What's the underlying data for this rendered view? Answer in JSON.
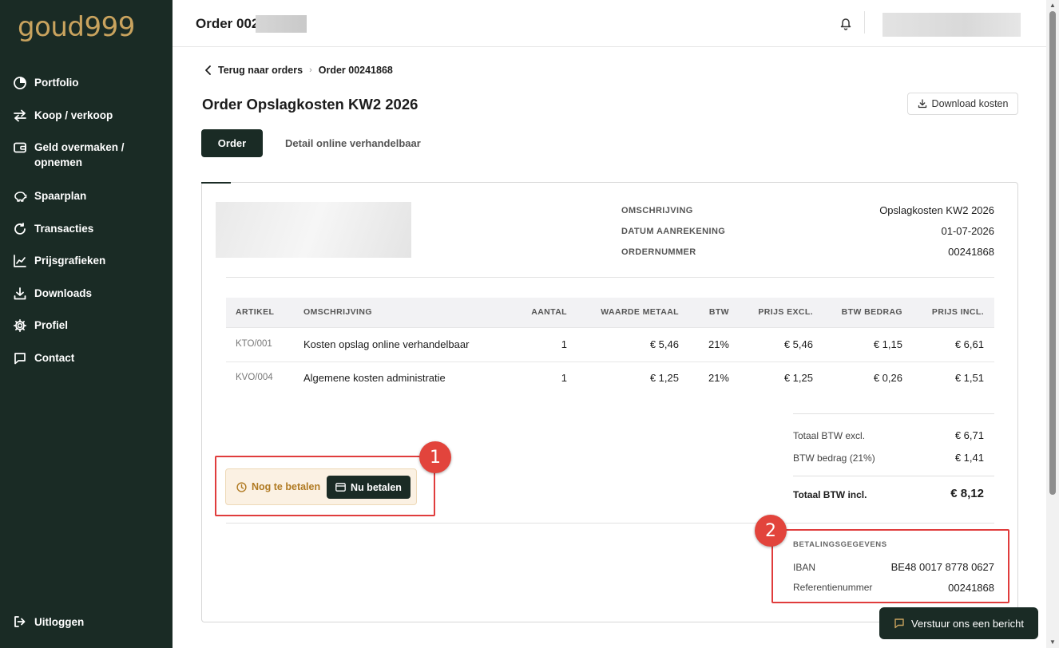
{
  "brand": {
    "logo_text": "goud999",
    "accent": "#c9a35e",
    "dark": "#1a2b25"
  },
  "sidebar": {
    "items": [
      {
        "label": "Portfolio",
        "icon": "pie-chart-icon"
      },
      {
        "label": "Koop / verkoop",
        "icon": "swap-arrows-icon"
      },
      {
        "label": "Geld overmaken / opnemen",
        "icon": "wallet-icon"
      },
      {
        "label": "Spaarplan",
        "icon": "piggy-bank-icon"
      },
      {
        "label": "Transacties",
        "icon": "history-icon"
      },
      {
        "label": "Prijsgrafieken",
        "icon": "line-chart-icon"
      },
      {
        "label": "Downloads",
        "icon": "download-icon"
      },
      {
        "label": "Profiel",
        "icon": "gear-icon"
      },
      {
        "label": "Contact",
        "icon": "chat-bubble-icon"
      }
    ],
    "logout": "Uitloggen"
  },
  "topbar": {
    "title": "Order 002"
  },
  "breadcrumb": {
    "back": "Terug naar orders",
    "current": "Order 00241868"
  },
  "page": {
    "title": "Order Opslagkosten KW2 2026",
    "download_button": "Download kosten"
  },
  "tabs": {
    "active": "Order",
    "other": "Detail online verhandelbaar"
  },
  "order_meta": {
    "omschrijving_label": "OMSCHRIJVING",
    "omschrijving_value": "Opslagkosten KW2 2026",
    "datum_label": "DATUM AANREKENING",
    "datum_value": "01-07-2026",
    "ordernummer_label": "ORDERNUMMER",
    "ordernummer_value": "00241868"
  },
  "table": {
    "headers": [
      "ARTIKEL",
      "OMSCHRIJVING",
      "AANTAL",
      "WAARDE METAAL",
      "BTW",
      "PRIJS EXCL.",
      "BTW BEDRAG",
      "PRIJS INCL."
    ],
    "rows": [
      [
        "KTO/001",
        "Kosten opslag online verhandelbaar",
        "1",
        "€ 5,46",
        "21%",
        "€ 5,46",
        "€ 1,15",
        "€ 6,61"
      ],
      [
        "KVO/004",
        "Algemene kosten administratie",
        "1",
        "€ 1,25",
        "21%",
        "€ 1,25",
        "€ 0,26",
        "€ 1,51"
      ]
    ]
  },
  "totals": {
    "excl_label": "Totaal BTW excl.",
    "excl_value": "€ 6,71",
    "btw_label": "BTW bedrag (21%)",
    "btw_value": "€ 1,41",
    "incl_label": "Totaal BTW incl.",
    "incl_value": "€ 8,12"
  },
  "payment": {
    "status": "Nog te betalen",
    "pay_button": "Nu betalen",
    "section_title": "BETALINGSGEGEVENS",
    "iban_label": "IBAN",
    "iban_value": "BE48 0017 8778 0627",
    "ref_label": "Referentienummer",
    "ref_value": "00241868"
  },
  "annotations": {
    "one": "1",
    "two": "2",
    "color": "#e03c3c"
  },
  "chat": {
    "label": "Verstuur ons een bericht"
  }
}
